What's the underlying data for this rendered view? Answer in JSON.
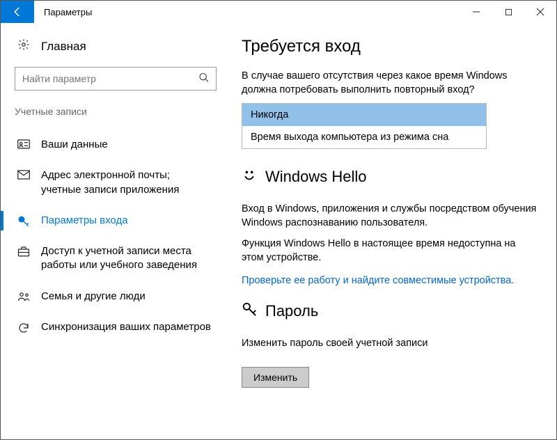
{
  "window": {
    "title": "Параметры"
  },
  "sidebar": {
    "home": "Главная",
    "search_placeholder": "Найти параметр",
    "category": "Учетные записи",
    "items": [
      {
        "label": "Ваши данные"
      },
      {
        "label": "Адрес электронной почты; учетные записи приложения"
      },
      {
        "label": "Параметры входа"
      },
      {
        "label": "Доступ к учетной записи места работы или учебного заведения"
      },
      {
        "label": "Семья и другие люди"
      },
      {
        "label": "Синхронизация ваших параметров"
      }
    ]
  },
  "content": {
    "signin_required_title": "Требуется вход",
    "signin_required_desc": "В случае вашего отсутствия через какое время Windows должна потребовать выполнить повторный вход?",
    "options": {
      "never": "Никогда",
      "wake": "Время выхода компьютера из режима сна"
    },
    "hello_title": "Windows Hello",
    "hello_desc": "Вход в Windows, приложения и службы посредством обучения Windows распознаванию пользователя.",
    "hello_unavailable": "Функция Windows Hello в настоящее время недоступна на этом устройстве.",
    "hello_link": "Проверьте ее работу и найдите совместимые устройства.",
    "password_title": "Пароль",
    "password_desc": "Изменить пароль своей учетной записи",
    "change_button": "Изменить"
  }
}
